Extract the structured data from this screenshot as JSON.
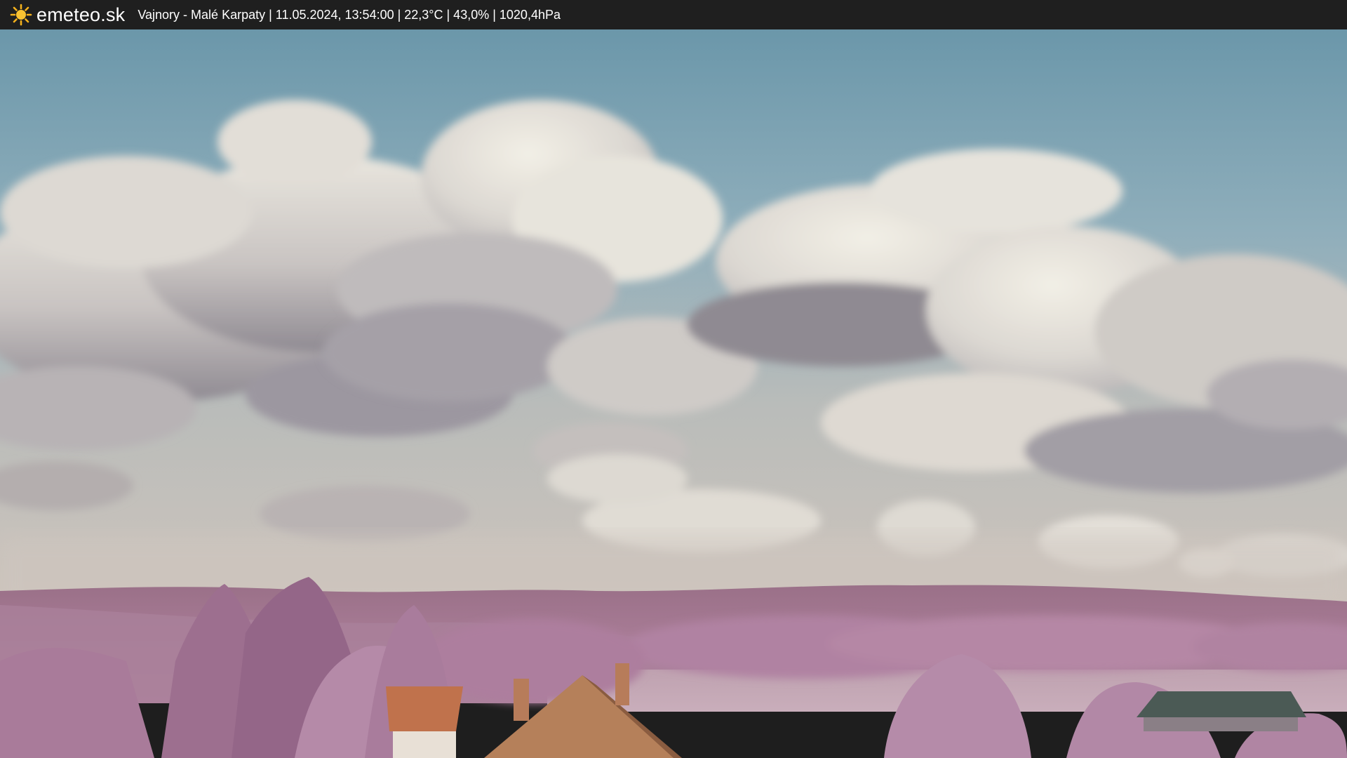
{
  "header": {
    "brand": "emeteo.sk",
    "logo_icon": "sun-icon",
    "caption": "Vajnory - Malé Karpaty | 11.05.2024, 13:54:00 | 22,3°C | 43,0% | 1020,4hPa"
  },
  "colors": {
    "bar": "#1f1f1f",
    "sun": "#f5b21b",
    "sky_top": "#6e9aab",
    "sky_horizon": "#c9c2bb",
    "hills": "#a0708f",
    "foliage": "#b27ea0",
    "roof": "#b97a52"
  }
}
